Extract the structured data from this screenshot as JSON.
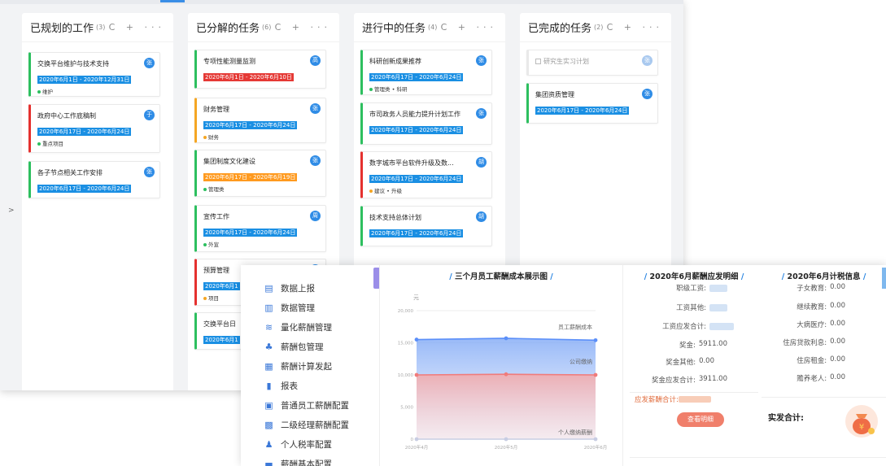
{
  "kanban": {
    "sidebar_toggle": ">",
    "actions": "C + ···",
    "columns": [
      {
        "title": "已规划的工作",
        "count": "(3)",
        "cards": [
          {
            "title": "交换平台维护与技术支持",
            "date": "2020年6月1日 - 2020年12月31日",
            "tag": "维护",
            "avatar": "张"
          },
          {
            "title": "政府中心工作底稿制",
            "date": "2020年6月17日 - 2020年6月24日",
            "tag": "重点项目",
            "avatar": "于"
          },
          {
            "title": "各子节点相关工作安排",
            "date": "2020年6月17日 - 2020年6月24日",
            "tag": "",
            "avatar": "张"
          }
        ]
      },
      {
        "title": "已分解的任务",
        "count": "(6)",
        "cards": [
          {
            "title": "专项性能测量监测",
            "date": "2020年6月1日 - 2020年6月10日",
            "tag": "",
            "avatar": "高"
          },
          {
            "title": "财务管理",
            "date": "2020年6月17日 - 2020年6月24日",
            "tag": "财务",
            "avatar": "张"
          },
          {
            "title": "集团制度文化建设",
            "date": "2020年6月17日 - 2020年6月19日",
            "tag": "管理类",
            "avatar": "张"
          },
          {
            "title": "宣传工作",
            "date": "2020年6月17日 - 2020年6月24日",
            "tag": "外宣",
            "avatar": "周"
          },
          {
            "title": "预算管理",
            "date": "2020年6月1",
            "tag": "项目",
            "avatar": "李"
          },
          {
            "title": "交换平台日",
            "date": "2020年6月1",
            "tag": "",
            "avatar": ""
          }
        ]
      },
      {
        "title": "进行中的任务",
        "count": "(4)",
        "cards": [
          {
            "title": "科研创新成果推荐",
            "date": "2020年6月17日 - 2020年6月24日",
            "tag": "管理类 • 科研",
            "avatar": "张"
          },
          {
            "title": "市司政务人员能力提升计划工作",
            "date": "2020年6月17日 - 2020年6月24日",
            "tag": "",
            "avatar": "张"
          },
          {
            "title": "数字城市平台软件升级及数...",
            "date": "2020年6月17日 - 2020年6月24日",
            "tag": "建议 • 升级",
            "avatar": "胡"
          },
          {
            "title": "技术支持总体计划",
            "date": "2020年6月17日 - 2020年6月24日",
            "tag": "",
            "avatar": "胡"
          }
        ]
      },
      {
        "title": "已完成的任务",
        "count": "(2)",
        "cards": [
          {
            "title": "研究生实习计划",
            "date": "",
            "tag": "",
            "avatar": "张"
          },
          {
            "title": "集团资质管理",
            "date": "2020年6月17日 - 2020年6月24日",
            "tag": "",
            "avatar": "张"
          }
        ]
      }
    ]
  },
  "payroll": {
    "menu": [
      {
        "label": "数据上报",
        "icon": "upload-icon",
        "glyph": "▤"
      },
      {
        "label": "数据管理",
        "icon": "database-icon",
        "glyph": "▥"
      },
      {
        "label": "量化薪酬管理",
        "icon": "scale-icon",
        "glyph": "≋"
      },
      {
        "label": "薪酬包管理",
        "icon": "package-icon",
        "glyph": "♣"
      },
      {
        "label": "薪酬计算发起",
        "icon": "calculator-icon",
        "glyph": "▦"
      },
      {
        "label": "报表",
        "icon": "report-icon",
        "glyph": "▮"
      },
      {
        "label": "普通员工薪酬配置",
        "icon": "employee-config-icon",
        "glyph": "▣"
      },
      {
        "label": "二级经理薪酬配置",
        "icon": "manager-config-icon",
        "glyph": "▩"
      },
      {
        "label": "个人税率配置",
        "icon": "tax-rate-icon",
        "glyph": "♟"
      },
      {
        "label": "薪酬基本配置",
        "icon": "base-config-icon",
        "glyph": "▬"
      }
    ],
    "chart_panel_title": "三个月员工薪酬成本展示图",
    "salary_panel": {
      "title": "2020年6月薪酬应发明细",
      "rows": [
        {
          "label": "职级工资:",
          "value": ""
        },
        {
          "label": "工资其他:",
          "value": ""
        },
        {
          "label": "工资应发合计:",
          "value": ""
        },
        {
          "label": "奖金:",
          "value": "5911.00"
        },
        {
          "label": "奖金其他:",
          "value": "0.00"
        },
        {
          "label": "奖金应发合计:",
          "value": "3911.00"
        }
      ],
      "net_total_label": "应发薪酬合计:",
      "view_button": "查看明细"
    },
    "tax_panel": {
      "title": "2020年6月计税信息",
      "rows": [
        {
          "label": "子女教育:",
          "value": "0.00"
        },
        {
          "label": "继续教育:",
          "value": "0.00"
        },
        {
          "label": "大病医疗:",
          "value": "0.00"
        },
        {
          "label": "住房贷款利息:",
          "value": "0.00"
        },
        {
          "label": "住房租金:",
          "value": "0.00"
        },
        {
          "label": "赡养老人:",
          "value": "0.00"
        }
      ],
      "actual_total_label": "实发合计:"
    }
  },
  "chart_data": {
    "type": "line",
    "title": "三个月员工薪酬成本展示图",
    "ylabel": "元",
    "ytick_labels": [
      "20,000",
      "15,000",
      "10,000",
      "5,000",
      "0"
    ],
    "ylim": [
      0,
      20000
    ],
    "categories": [
      "2020年4月",
      "2020年5月",
      "2020年6月"
    ],
    "series": [
      {
        "name": "员工薪酬成本",
        "values": [
          15500,
          15700,
          15400
        ],
        "color": "#5b8ff9"
      },
      {
        "name": "公司缴纳",
        "values": [
          10000,
          10100,
          10000
        ],
        "color": "#f07b7b"
      },
      {
        "name": "个人缴纳薪酬",
        "values": [
          0,
          0,
          0
        ],
        "color": "#c8cde3"
      }
    ],
    "grid": true
  }
}
